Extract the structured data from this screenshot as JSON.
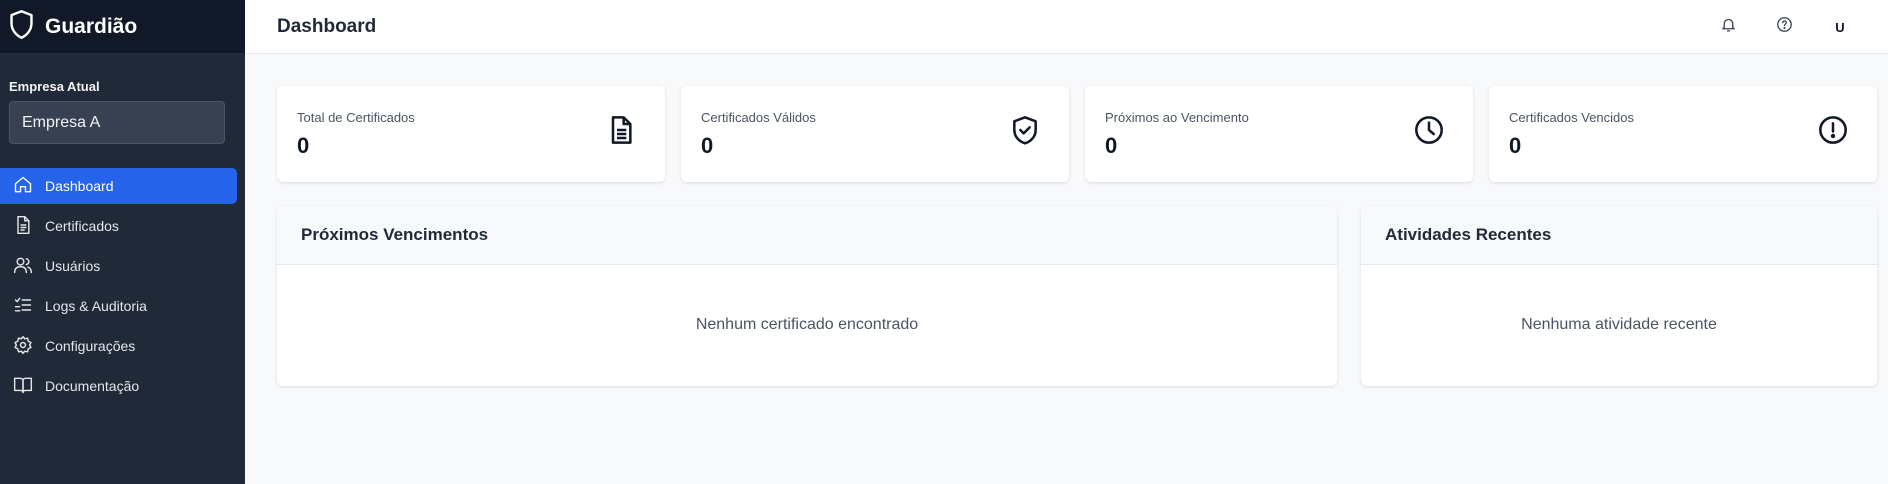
{
  "brand": {
    "name": "Guardião"
  },
  "company": {
    "label": "Empresa Atual",
    "selected": "Empresa A"
  },
  "nav": [
    {
      "label": "Dashboard",
      "icon": "home-icon",
      "active": true
    },
    {
      "label": "Certificados",
      "icon": "document-icon",
      "active": false
    },
    {
      "label": "Usuários",
      "icon": "users-icon",
      "active": false
    },
    {
      "label": "Logs & Auditoria",
      "icon": "list-checks-icon",
      "active": false
    },
    {
      "label": "Configurações",
      "icon": "gear-icon",
      "active": false
    },
    {
      "label": "Documentação",
      "icon": "book-icon",
      "active": false
    }
  ],
  "header": {
    "title": "Dashboard",
    "avatar": "U",
    "icons": [
      "bell-icon",
      "help-icon"
    ]
  },
  "stats": [
    {
      "label": "Total de Certificados",
      "value": "0",
      "icon": "document-icon"
    },
    {
      "label": "Certificados Válidos",
      "value": "0",
      "icon": "shield-check-icon"
    },
    {
      "label": "Próximos ao Vencimento",
      "value": "0",
      "icon": "clock-icon"
    },
    {
      "label": "Certificados Vencidos",
      "value": "0",
      "icon": "alert-circle-icon"
    }
  ],
  "panels": {
    "upcoming": {
      "title": "Próximos Vencimentos",
      "empty": "Nenhum certificado encontrado"
    },
    "activity": {
      "title": "Atividades Recentes",
      "empty": "Nenhuma atividade recente"
    }
  },
  "colors": {
    "sidebar": "#1f2937",
    "brand_bar": "#111827",
    "accent": "#2563eb",
    "background": "#f8f9fb"
  }
}
